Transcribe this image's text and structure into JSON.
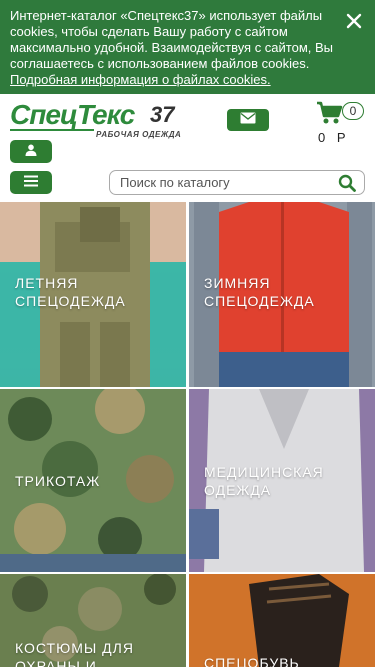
{
  "cookie_banner": {
    "text": "Интернет-каталог «Спецтекс37» использует файлы cookies, чтобы сделать Вашу работу с сайтом максимально удобной. Взаимодействуя с сайтом, Вы соглашаетесь с использованием файлов cookies.",
    "link_text": "Подробная информация о файлах cookies.",
    "close_icon": "close-icon"
  },
  "header": {
    "logo": {
      "main": "СпецТекс",
      "number": "37",
      "subtitle": "РАБОЧАЯ ОДЕЖДА"
    },
    "mail_icon": "mail-icon",
    "user_icon": "user-icon",
    "menu_icon": "menu-icon",
    "cart": {
      "icon": "cart-icon",
      "count": "0",
      "sum": "0 Р"
    },
    "search": {
      "placeholder": "Поиск по каталогу",
      "value": "",
      "icon": "search-icon"
    }
  },
  "categories": [
    {
      "label": "ЛЕТНЯЯ СПЕЦОДЕЖДА"
    },
    {
      "label": "ЗИМНЯЯ СПЕЦОДЕЖДА"
    },
    {
      "label": "ТРИКОТАЖ"
    },
    {
      "label": "МЕДИЦИНСКАЯ ОДЕЖДА"
    },
    {
      "label": "КОСТЮМЫ ДЛЯ ОХРАНЫ И"
    },
    {
      "label": "СПЕЦОБУВЬ"
    }
  ],
  "colors": {
    "accent": "#2e7d32",
    "cookie_bg": "#2f7a3c"
  }
}
